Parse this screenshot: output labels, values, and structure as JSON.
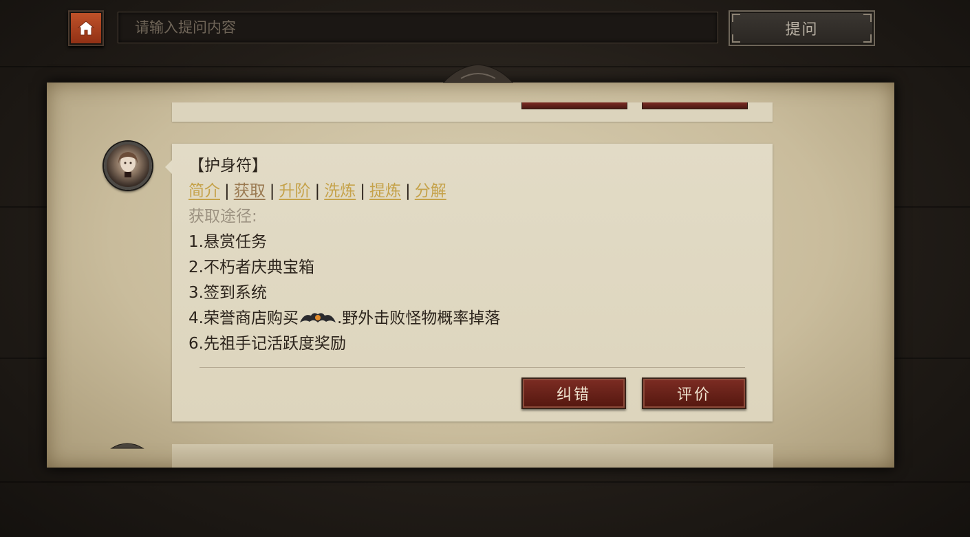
{
  "header": {
    "search_placeholder": "请输入提问内容",
    "ask_label": "提问"
  },
  "card": {
    "title": "【护身符】",
    "tabs": [
      {
        "label": "简介"
      },
      {
        "label": "获取"
      },
      {
        "label": "升阶"
      },
      {
        "label": "洗炼"
      },
      {
        "label": "提炼"
      },
      {
        "label": "分解"
      }
    ],
    "tab_separator": "|",
    "section_label": "获取途径:",
    "items": [
      "1.悬赏任务",
      "2.不朽者庆典宝箱",
      "3.签到系统",
      "4.荣誉商店购买",
      ".野外击败怪物概率掉落",
      "6.先祖手记活跃度奖励"
    ],
    "correct_label": "纠错",
    "rate_label": "评价"
  },
  "colors": {
    "link": "#c5a24a",
    "active_link": "#9a7a52",
    "button_red": "#7c2c23",
    "home_orange": "#c2532a"
  },
  "icons": [
    "home-icon",
    "bat-emoji-icon",
    "avatar-portrait"
  ]
}
